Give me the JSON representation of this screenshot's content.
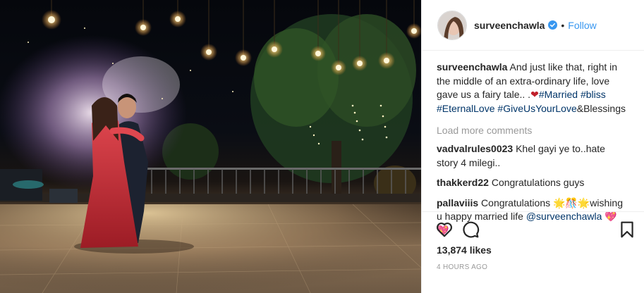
{
  "post": {
    "image_alt_subject": "couple-dancing-photo",
    "author": {
      "username": "surveenchawla",
      "verified": true,
      "follow_label": "Follow",
      "separator": "•"
    },
    "caption": {
      "username": "surveenchawla",
      "text": " And just like that, right in the middle of an extra-ordinary life, love gave us a fairy tale.. .",
      "heart": "❤",
      "tags": [
        "#Married",
        "#bliss",
        "#EternalLove",
        "#GiveUsYourLove"
      ],
      "tail": "&Blessings"
    },
    "load_more_label": "Load more comments",
    "comments": [
      {
        "username": "vadvalrules0023",
        "text": " Khel gayi ye to..hate story 4 milegi.."
      },
      {
        "username": "thakkerd22",
        "text": " Congratulations guys"
      },
      {
        "username": "pallaviiis",
        "text": " Congratulations ",
        "emoji": "🌟🎊🌟",
        "text2": "wishing u happy married life ",
        "mention": "@surveenchawla",
        "emoji2": " 💖💖"
      }
    ],
    "likes": "13,874 likes",
    "time": "4 hours ago"
  },
  "icons": [
    "heart-icon",
    "comment-icon",
    "bookmark-icon",
    "verified-icon"
  ],
  "colors": {
    "link": "#3897f0",
    "hashtag": "#003569",
    "muted": "#999999",
    "text": "#262626",
    "border": "#efefef"
  }
}
